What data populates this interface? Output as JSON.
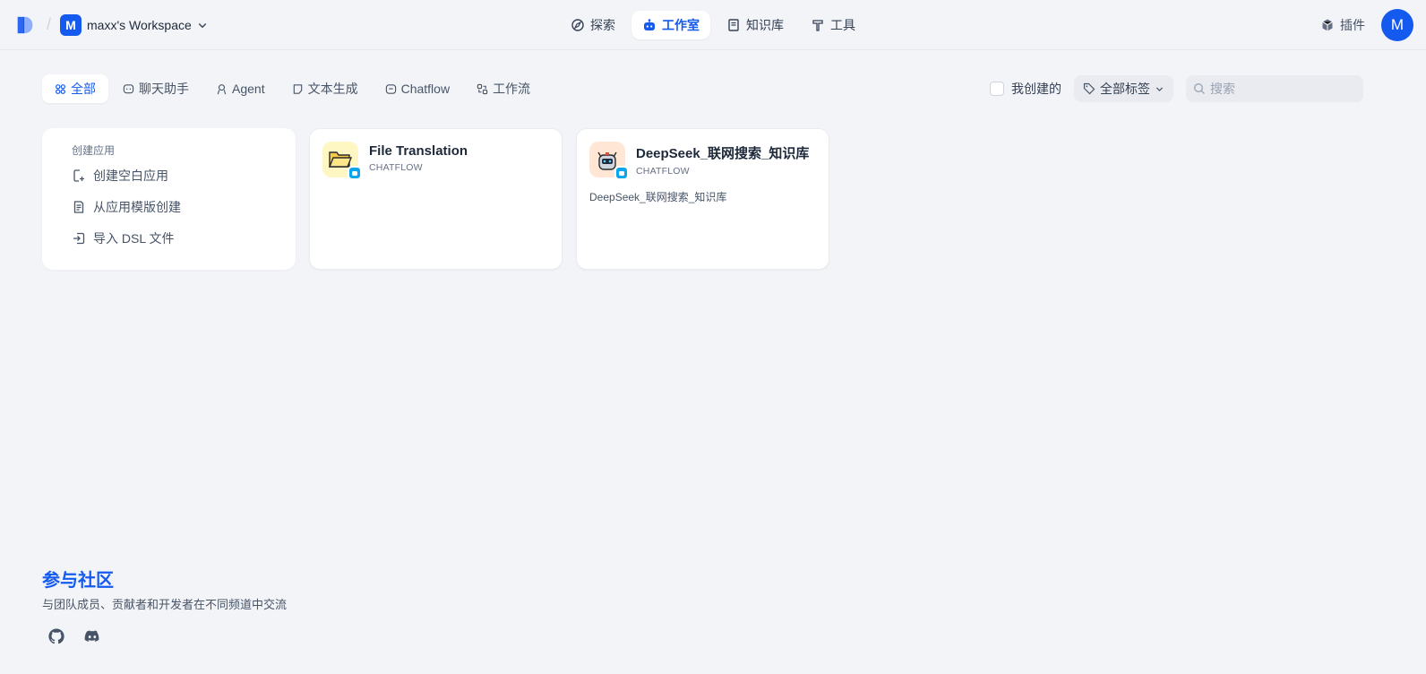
{
  "header": {
    "workspace_initial": "M",
    "workspace_name": "maxx's Workspace",
    "nav": [
      {
        "label": "探索",
        "icon": "compass-icon"
      },
      {
        "label": "工作室",
        "icon": "robot-icon",
        "active": true
      },
      {
        "label": "知识库",
        "icon": "book-icon"
      },
      {
        "label": "工具",
        "icon": "hammer-icon"
      }
    ],
    "plugins_label": "插件",
    "user_initial": "M"
  },
  "tabs": [
    {
      "label": "全部",
      "icon": "grid-icon",
      "active": true
    },
    {
      "label": "聊天助手",
      "icon": "chat-icon"
    },
    {
      "label": "Agent",
      "icon": "agent-icon"
    },
    {
      "label": "文本生成",
      "icon": "note-icon"
    },
    {
      "label": "Chatflow",
      "icon": "chatflow-icon"
    },
    {
      "label": "工作流",
      "icon": "workflow-icon"
    }
  ],
  "filters": {
    "created_by_me": "我创建的",
    "tags": "全部标签",
    "search_placeholder": "搜索"
  },
  "create": {
    "title": "创建应用",
    "items": [
      "创建空白应用",
      "从应用模版创建",
      "导入 DSL 文件"
    ]
  },
  "apps": [
    {
      "name": "File Translation",
      "type": "CHATFLOW",
      "description": "",
      "icon": "folder-emoji",
      "icon_bg": "#fef7c3"
    },
    {
      "name": "DeepSeek_联网搜索_知识库",
      "type": "CHATFLOW",
      "description": "DeepSeek_联网搜索_知识库",
      "icon": "robot-emoji",
      "icon_bg": "#ffe6d5"
    }
  ],
  "footer": {
    "title": "参与社区",
    "subtitle": "与团队成员、贡献者和开发者在不同频道中交流"
  },
  "colors": {
    "accent": "#155aef",
    "background": "#f2f4f7",
    "badge": "#0ba5ec"
  }
}
